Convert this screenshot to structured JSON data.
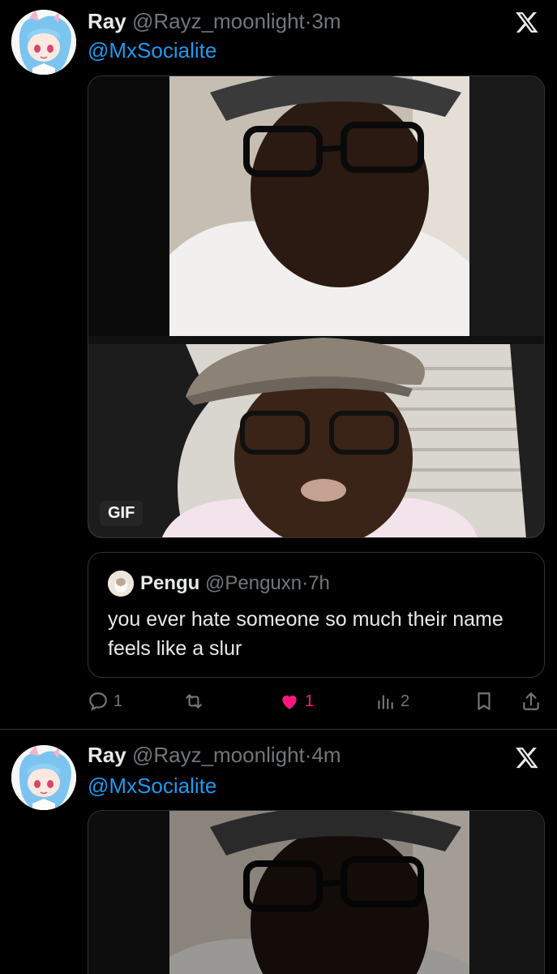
{
  "tweets": [
    {
      "name": "Ray",
      "handle": "@Rayz_moonlight",
      "separator": "·",
      "time": "3m",
      "reply_to": "@MxSocialite",
      "media_badge": "GIF",
      "quote": {
        "name": "Pengu",
        "handle": "@Penguxn",
        "separator": "·",
        "time": "7h",
        "text": "you ever hate someone so much their name feels like a slur"
      },
      "actions": {
        "replies": "1",
        "retweets": "",
        "likes": "1",
        "views": "2"
      }
    },
    {
      "name": "Ray",
      "handle": "@Rayz_moonlight",
      "separator": "·",
      "time": "4m",
      "reply_to": "@MxSocialite"
    }
  ],
  "colors": {
    "background": "#000000",
    "text": "#e7e9ea",
    "muted": "#71767b",
    "link": "#1d9bf0",
    "like": "#f91880",
    "border": "#2f3336"
  },
  "icons": [
    "x-logo-icon",
    "reply-icon",
    "retweet-icon",
    "heart-icon",
    "views-icon",
    "bookmark-icon",
    "share-icon"
  ]
}
